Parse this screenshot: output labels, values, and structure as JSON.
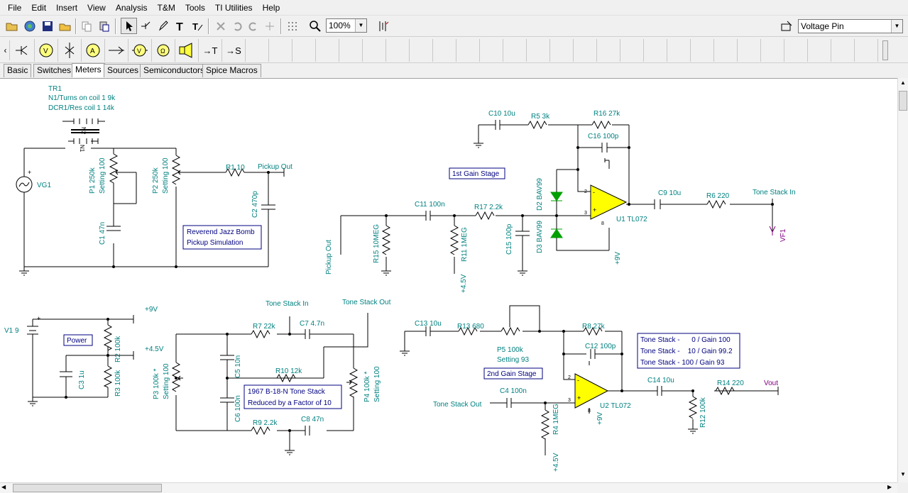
{
  "menu": [
    "File",
    "Edit",
    "Insert",
    "View",
    "Analysis",
    "T&M",
    "Tools",
    "TI Utilities",
    "Help"
  ],
  "toolbar": {
    "zoom": "100%",
    "probe_select": "Voltage Pin"
  },
  "tabs": [
    "Basic",
    "Switches",
    "Meters",
    "Sources",
    "Semiconductors",
    "Spice Macros"
  ],
  "active_tab": "Meters",
  "meter_icons": [
    "ammeter-probe-icon",
    "voltmeter-icon",
    "sensor-icon",
    "ammeter-icon",
    "current-arrow-icon",
    "voltmeter-lamp-icon",
    "ohmmeter-lamp-icon",
    "speaker-icon",
    "text-arrow-icon",
    "signal-arrow-icon"
  ],
  "meter_labels": {
    "text_arrow": "→T",
    "signal_arrow": "→S"
  },
  "schematic": {
    "tr1": {
      "name": "TR1",
      "l1": "N1/Turns on coil 1 9k",
      "l2": "DCR1/Res coil 1 14k",
      "n1": "N1",
      "n2": "N2"
    },
    "vg1": "VG1",
    "p1": {
      "l1": "P1 250k",
      "l2": "Setting 100"
    },
    "p2": {
      "l1": "P2 250k",
      "l2": "Setting 100"
    },
    "c1": "C1 47n",
    "r1": "R1 10",
    "pickup_out": "Pickup Out",
    "c2": "C2 470p",
    "note1": {
      "l1": "Reverend Jazz Bomb",
      "l2": "Pickup Simulation"
    },
    "c10": "C10 10u",
    "r5": "R5 3k",
    "r16": "R16 27k",
    "c16": "C16 100p",
    "stage1": "1st Gain Stage",
    "d2": "D2 BAV99",
    "d3": "D3 BAV99",
    "c11": "C11 100n",
    "r17": "R17 2.2k",
    "c9": "C9 10u",
    "r6": "R6 220",
    "tone_in": "Tone Stack In",
    "vf1": "VF1",
    "u1": "U1 TL072",
    "pickup_out2": "Pickup Out",
    "r15": "R15 10MEG",
    "r11": "R11 1MEG",
    "c15": "C15 100p",
    "p45": "+4.5V",
    "p9": "+9V",
    "v1": "V1 9",
    "power": "Power",
    "r2": "R2 100k",
    "r3": "R3 100k",
    "c3": "C3 1u",
    "tone_in2": "Tone Stack In",
    "tone_out": "Tone Stack Out",
    "r7": "R7 22k",
    "c7": "C7 4.7n",
    "c5": "C5 10n",
    "r10": "R10 12k",
    "p3": {
      "l1": "P3 100k *",
      "l2": "Setting 100"
    },
    "p4": {
      "l1": "P4 100k *",
      "l2": "Setting 100"
    },
    "c6": "C6 100n",
    "note2": {
      "l1": "1967 B-18-N Tone Stack",
      "l2": "Reduced by a Factor of 10"
    },
    "r9": "R9 2.2k",
    "c8": "C8 47n",
    "c13": "C13 10u",
    "r13": "R13 680",
    "p5": {
      "l1": "P5 100k",
      "l2": "Setting 93"
    },
    "r8": "R8 27k",
    "c12": "C12 100p",
    "stage2": "2nd Gain Stage",
    "c4": "C4 100n",
    "tone_out2": "Tone Stack Out",
    "r4": "R4 1MEG",
    "u2": "U2 TL072",
    "c14": "C14 10u",
    "r14": "R14 220",
    "vout": "Vout",
    "r12": "R12 100k",
    "gain_table": [
      "Tone Stack -      0 / Gain 100",
      "Tone Stack -    10 / Gain 99.2",
      "Tone Stack - 100 / Gain 93"
    ]
  },
  "colors": {
    "wire": "#000000",
    "label": "#008080",
    "note": "#000080",
    "opamp": "#ffff00",
    "diode": "#00a000",
    "probe": "#800080"
  }
}
